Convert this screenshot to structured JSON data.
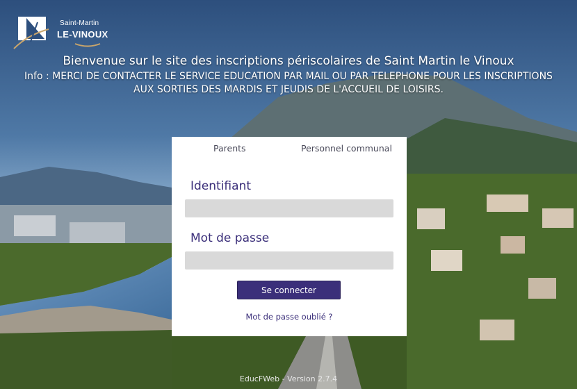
{
  "logo": {
    "line1": "Saint-Martin",
    "line2": "LE-VINOUX"
  },
  "header": {
    "title": "Bienvenue sur le site des inscriptions périscolaires de Saint Martin le Vinoux",
    "info_line1": "Info : MERCI DE CONTACTER LE SERVICE EDUCATION PAR MAIL OU PAR TELEPHONE POUR LES INSCRIPTIONS",
    "info_line2": "AUX SORTIES DES MARDIS ET JEUDIS DE L'ACCUEIL DE LOISIRS."
  },
  "login": {
    "tabs": [
      {
        "label": "Parents"
      },
      {
        "label": "Personnel communal"
      }
    ],
    "username_label": "Identifiant",
    "username_value": "",
    "password_label": "Mot de passe",
    "password_value": "",
    "submit_label": "Se connecter",
    "forgot_label": "Mot de passe oublié ?"
  },
  "footer": {
    "version": "EducFWeb - Version 2.7.4"
  },
  "colors": {
    "accent": "#3b2f7a",
    "field_bg": "#d9d9d9"
  }
}
